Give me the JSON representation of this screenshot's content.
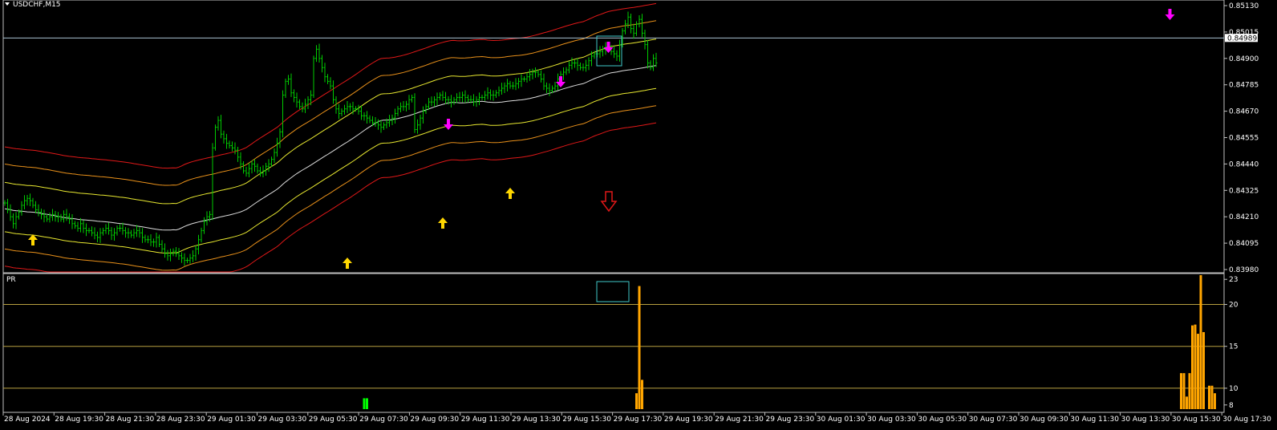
{
  "window": {
    "symbol_label": "USDCHF,M15",
    "indicator_label": "PR",
    "current_price_label": "0.84989"
  },
  "colors": {
    "background": "#000000",
    "frame": "#c0c0c0",
    "candle": "#00cc00",
    "band_mid": "#dcdcdc",
    "band_1": "#e8e830",
    "band_2": "#e8901a",
    "band_3": "#e01818",
    "arrow_up": "#ffd700",
    "arrow_down": "#ff00ff",
    "hollow_arrow": "#e01818",
    "highlight_box": "#40c8c8",
    "current_price_line": "#a8c0d0",
    "histogram": "#ffa500",
    "histogram_low": "#00ff00",
    "level_line": "#b8a040"
  },
  "chart_data": [
    {
      "type": "line",
      "name": "price-chart",
      "x_axis_labels": [
        "28 Aug 2024",
        "28 Aug 19:30",
        "28 Aug 21:30",
        "28 Aug 23:30",
        "29 Aug 01:30",
        "29 Aug 03:30",
        "29 Aug 05:30",
        "29 Aug 07:30",
        "29 Aug 09:30",
        "29 Aug 11:30",
        "29 Aug 13:30",
        "29 Aug 15:30",
        "29 Aug 17:30",
        "29 Aug 19:30",
        "29 Aug 21:30",
        "29 Aug 23:30",
        "30 Aug 01:30",
        "30 Aug 03:30",
        "30 Aug 05:30",
        "30 Aug 07:30",
        "30 Aug 09:30",
        "30 Aug 11:30",
        "30 Aug 13:30",
        "30 Aug 15:30",
        "30 Aug 17:30"
      ],
      "y_ticks": [
        "0.85130",
        "0.85015",
        "0.84900",
        "0.84785",
        "0.84670",
        "0.84555",
        "0.84440",
        "0.84325",
        "0.84210",
        "0.84095",
        "0.83980"
      ],
      "ylim": [
        0.8398,
        0.8513
      ],
      "current_price": 0.84989,
      "close": [
        0.8427,
        0.8424,
        0.8421,
        0.8418,
        0.8421,
        0.8423,
        0.8426,
        0.8428,
        0.8429,
        0.8428,
        0.8426,
        0.8424,
        0.8423,
        0.8422,
        0.8421,
        0.842,
        0.8421,
        0.8422,
        0.8421,
        0.8421,
        0.842,
        0.8422,
        0.8421,
        0.842,
        0.8418,
        0.8417,
        0.8416,
        0.8418,
        0.8416,
        0.8415,
        0.8415,
        0.8414,
        0.8413,
        0.8412,
        0.8414,
        0.8415,
        0.8416,
        0.8415,
        0.8413,
        0.8414,
        0.8416,
        0.8416,
        0.8415,
        0.8414,
        0.8414,
        0.8413,
        0.8414,
        0.8415,
        0.8414,
        0.8412,
        0.8411,
        0.8411,
        0.841,
        0.841,
        0.8412,
        0.8409,
        0.8407,
        0.8405,
        0.8404,
        0.8405,
        0.8406,
        0.8405,
        0.8404,
        0.8403,
        0.8402,
        0.8402,
        0.8403,
        0.8404,
        0.8407,
        0.8411,
        0.8415,
        0.8419,
        0.8421,
        0.8422,
        0.8451,
        0.846,
        0.8463,
        0.8457,
        0.8455,
        0.8453,
        0.8452,
        0.8451,
        0.845,
        0.8447,
        0.8444,
        0.8441,
        0.844,
        0.8442,
        0.8444,
        0.8443,
        0.8441,
        0.844,
        0.8441,
        0.8443,
        0.8444,
        0.8446,
        0.8449,
        0.8453,
        0.8458,
        0.8474,
        0.848,
        0.8481,
        0.8475,
        0.8473,
        0.8471,
        0.8469,
        0.8468,
        0.847,
        0.8472,
        0.8474,
        0.849,
        0.8494,
        0.849,
        0.8486,
        0.8482,
        0.848,
        0.8478,
        0.8472,
        0.8468,
        0.8466,
        0.8467,
        0.8468,
        0.8469,
        0.8469,
        0.8468,
        0.8468,
        0.8467,
        0.8465,
        0.8465,
        0.8464,
        0.8463,
        0.8462,
        0.8462,
        0.8461,
        0.846,
        0.8461,
        0.8462,
        0.8463,
        0.8464,
        0.8466,
        0.8468,
        0.8469,
        0.8469,
        0.847,
        0.8472,
        0.8473,
        0.8459,
        0.8461,
        0.8464,
        0.8467,
        0.8469,
        0.8471,
        0.8471,
        0.8472,
        0.8473,
        0.8474,
        0.8473,
        0.8472,
        0.8472,
        0.8471,
        0.8472,
        0.8473,
        0.8473,
        0.8474,
        0.8473,
        0.8472,
        0.8472,
        0.8471,
        0.8472,
        0.8473,
        0.8473,
        0.8474,
        0.8475,
        0.8474,
        0.8474,
        0.8475,
        0.8476,
        0.8477,
        0.8478,
        0.8479,
        0.8478,
        0.8478,
        0.8479,
        0.848,
        0.8481,
        0.8481,
        0.8482,
        0.8483,
        0.8484,
        0.8484,
        0.8483,
        0.8481,
        0.8478,
        0.8477,
        0.8476,
        0.8477,
        0.8478,
        0.8481,
        0.8483,
        0.8484,
        0.8485,
        0.8487,
        0.8488,
        0.8488,
        0.8487,
        0.8486,
        0.8486,
        0.8487,
        0.8489,
        0.8491,
        0.8492,
        0.8492,
        0.8493,
        0.8494,
        0.8495,
        0.8494,
        0.8493,
        0.8492,
        0.8491,
        0.8496,
        0.8502,
        0.8505,
        0.8508,
        0.8503,
        0.8501,
        0.8505,
        0.8507,
        0.8501,
        0.8496,
        0.8488,
        0.8486,
        0.849,
        0.8488
      ]
    },
    {
      "type": "bar",
      "name": "PR",
      "y_ticks": [
        "23",
        "20",
        "15",
        "10",
        "8"
      ],
      "ylim": [
        7.5,
        23.5
      ],
      "levels": [
        20,
        15,
        10
      ],
      "bars": [
        {
          "x_index": 128,
          "value": 8.8,
          "color": "green"
        },
        {
          "x_index": 129,
          "value": 8.8,
          "color": "green"
        },
        {
          "x_index": 225,
          "value": 9.4,
          "color": "orange"
        },
        {
          "x_index": 226,
          "value": 22.2,
          "color": "orange"
        },
        {
          "x_index": 227,
          "value": 11.0,
          "color": "orange"
        },
        {
          "x_index": 419,
          "value": 11.8,
          "color": "orange"
        },
        {
          "x_index": 420,
          "value": 11.8,
          "color": "orange"
        },
        {
          "x_index": 421,
          "value": 9.0,
          "color": "orange"
        },
        {
          "x_index": 422,
          "value": 11.8,
          "color": "orange"
        },
        {
          "x_index": 423,
          "value": 17.5,
          "color": "orange"
        },
        {
          "x_index": 424,
          "value": 17.6,
          "color": "orange"
        },
        {
          "x_index": 425,
          "value": 16.5,
          "color": "orange"
        },
        {
          "x_index": 426,
          "value": 23.5,
          "color": "orange"
        },
        {
          "x_index": 427,
          "value": 16.7,
          "color": "orange"
        },
        {
          "x_index": 429,
          "value": 10.3,
          "color": "orange"
        },
        {
          "x_index": 430,
          "value": 10.3,
          "color": "orange"
        },
        {
          "x_index": 431,
          "value": 9.4,
          "color": "orange"
        }
      ]
    }
  ]
}
